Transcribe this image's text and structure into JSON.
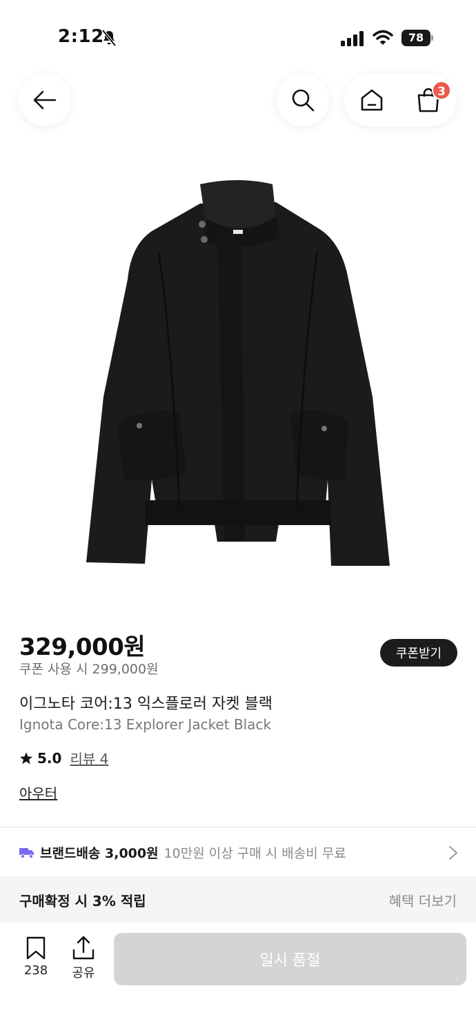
{
  "status_bar": {
    "time": "2:12",
    "battery": "78"
  },
  "nav": {
    "back_icon": "arrow-left-icon",
    "search_icon": "search-icon",
    "home_icon": "home-icon",
    "cart_icon": "shopping-bag-icon",
    "cart_count": "3",
    "badge_color": "#f0584a"
  },
  "product": {
    "image_icon": "black-jacket-image",
    "price": "329,000원",
    "coupon_price": "쿠폰 사용 시 299,000원",
    "coupon_button": "쿠폰받기",
    "name_ko": "이그노타 코어:13 익스플로러 자켓 블랙",
    "name_en": "Ignota Core:13 Explorer Jacket Black",
    "rating": "5.0",
    "reviews": "리뷰 4",
    "category": "아우터"
  },
  "shipping": {
    "icon": "truck-icon",
    "title": "브랜드배송 3,000원",
    "note": "10만원 이상 구매 시 배송비 무료",
    "accent_color": "#7a6cf0"
  },
  "benefit": {
    "title": "구매확정 시 3% 적립",
    "more": "혜택 더보기"
  },
  "bottom_bar": {
    "like_count": "238",
    "share_label": "공유",
    "soldout_label": "일시 품절"
  }
}
